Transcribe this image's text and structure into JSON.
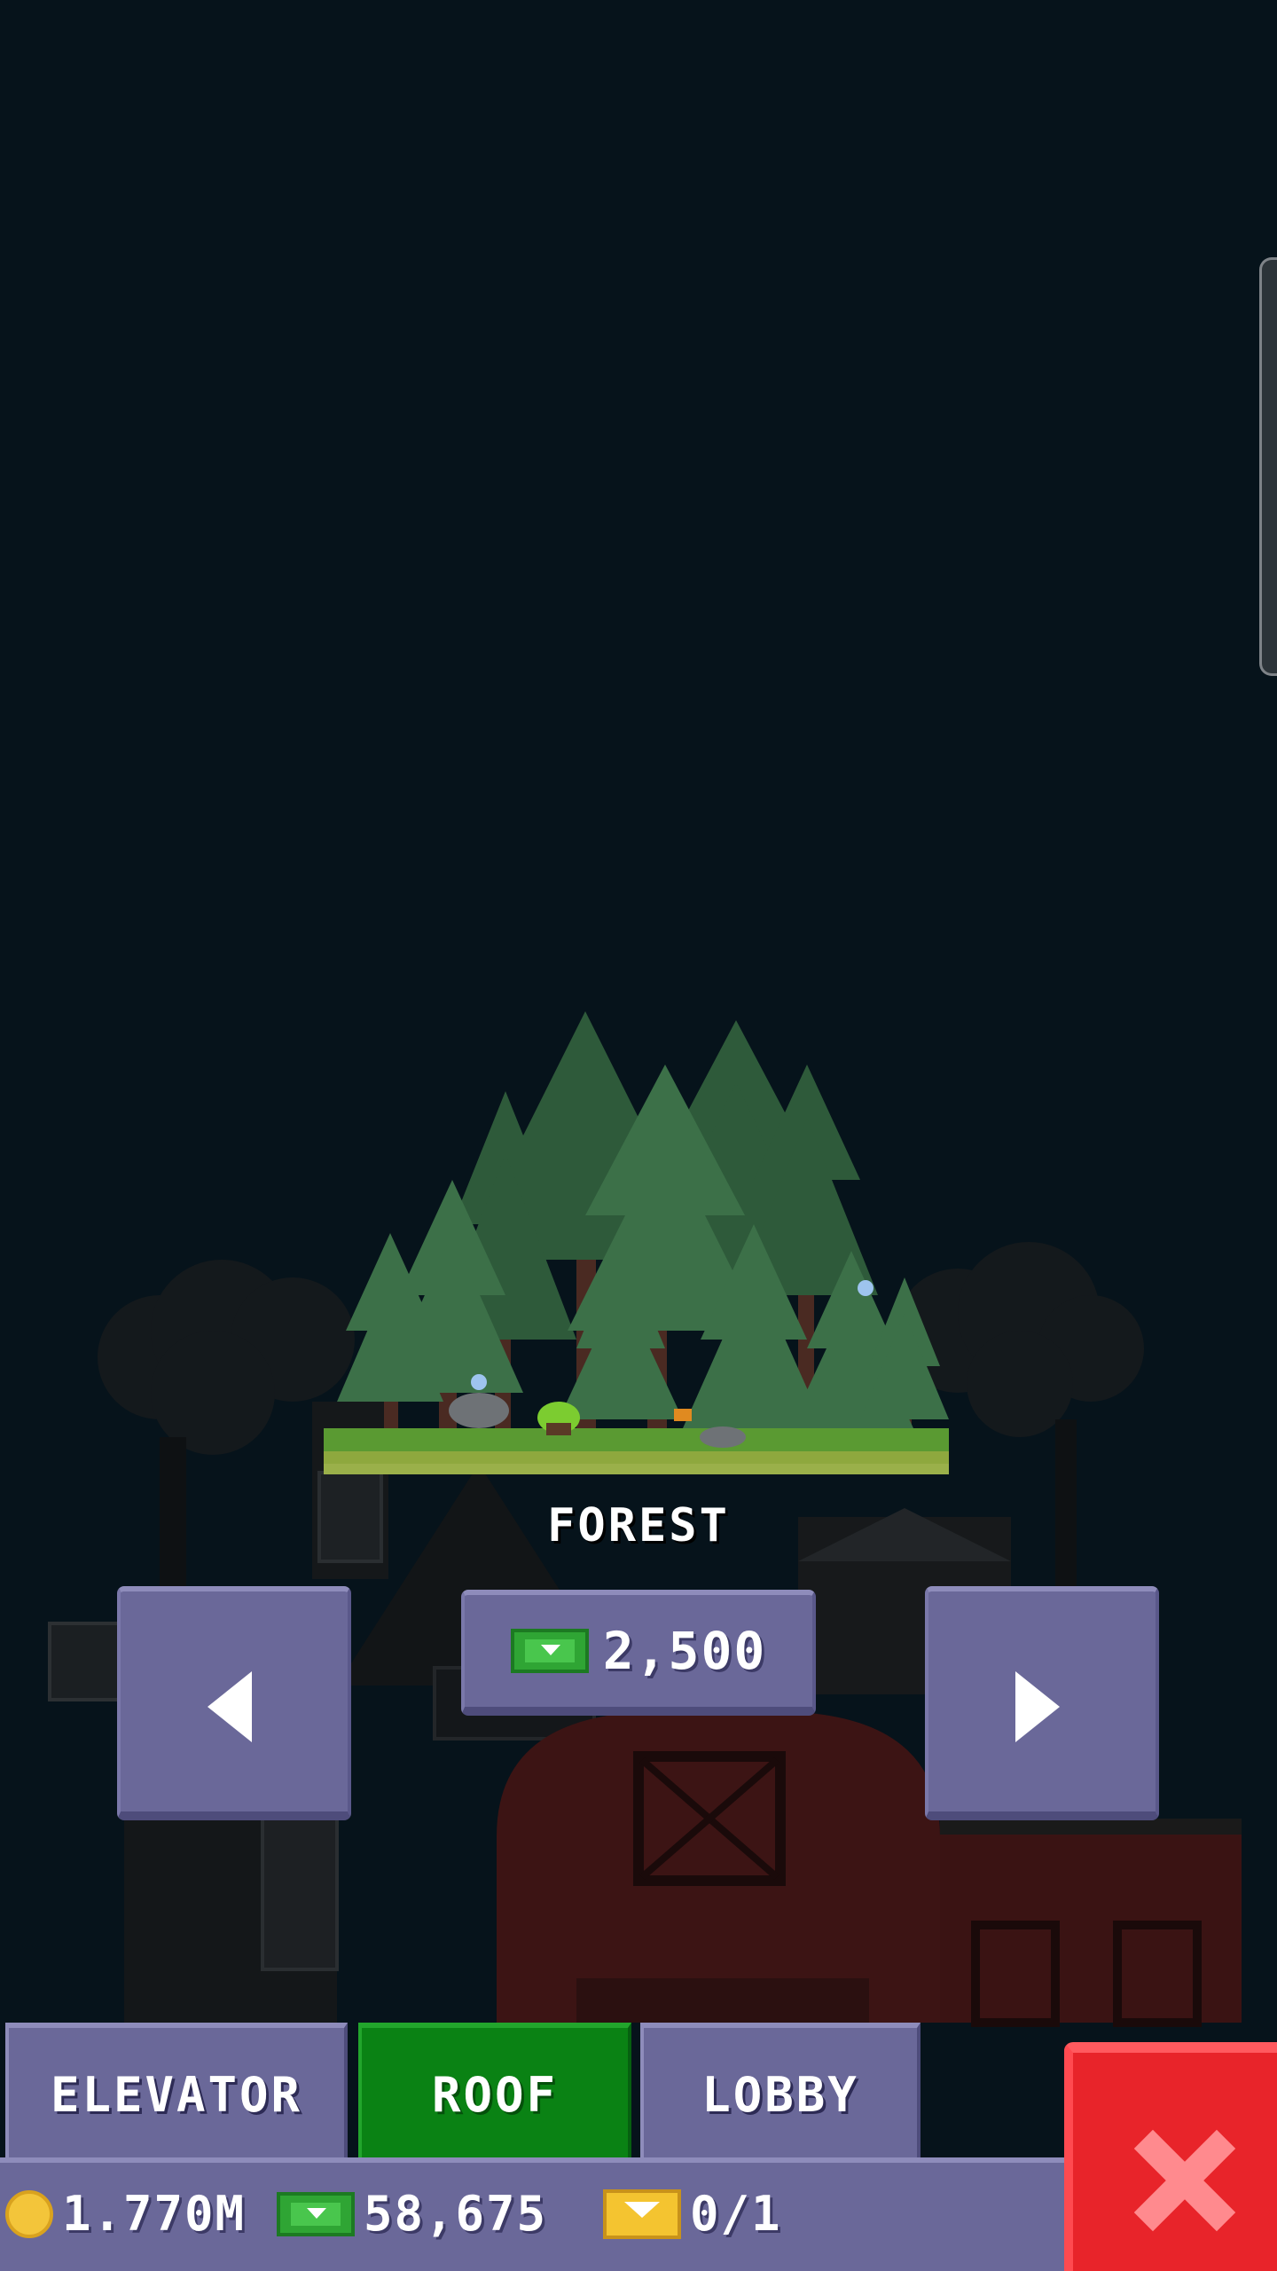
{
  "roof_selector": {
    "name": "FOREST",
    "price": "2,500",
    "price_currency_icon": "bux-icon",
    "prev_icon": "arrow-left-icon",
    "next_icon": "arrow-right-icon"
  },
  "tabs": [
    {
      "label": "ELEVATOR",
      "active": false
    },
    {
      "label": "ROOF",
      "active": true
    },
    {
      "label": "LOBBY",
      "active": false
    }
  ],
  "status": {
    "coins": "1.770M",
    "bux": "58,675",
    "vip": "0/1"
  },
  "colors": {
    "background": "#06131b",
    "button_purple": "#6a6899",
    "tab_active_green": "#0a8214",
    "close_red": "#e8242a",
    "bux_green": "#2fa534",
    "coin_gold": "#f3c53a"
  }
}
